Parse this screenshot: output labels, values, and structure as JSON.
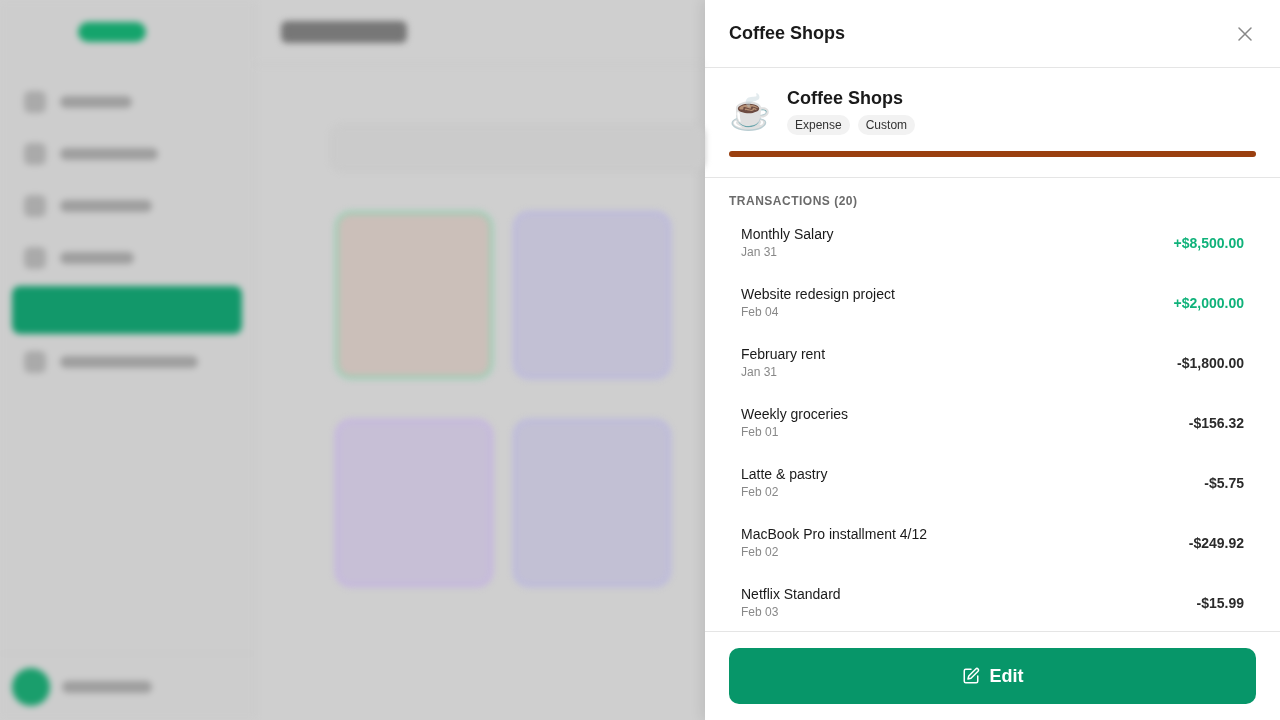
{
  "panel": {
    "title": "Coffee Shops",
    "category": {
      "emoji": "☕",
      "name": "Coffee Shops",
      "tags": [
        "Expense",
        "Custom"
      ],
      "level": 1
    },
    "section_title": "TRANSACTIONS (20)",
    "transactions": [
      {
        "description": "Monthly Salary",
        "date": "Jan 31",
        "amount": "+$8,500.00",
        "kind": "income"
      },
      {
        "description": "Website redesign project",
        "date": "Feb 04",
        "amount": "+$2,000.00",
        "kind": "income"
      },
      {
        "description": "February rent",
        "date": "Jan 31",
        "amount": "-$1,800.00",
        "kind": "expense"
      },
      {
        "description": "Weekly groceries",
        "date": "Feb 01",
        "amount": "-$156.32",
        "kind": "expense"
      },
      {
        "description": "Latte & pastry",
        "date": "Feb 02",
        "amount": "-$5.75",
        "kind": "expense"
      },
      {
        "description": "MacBook Pro installment 4/12",
        "date": "Feb 02",
        "amount": "-$249.92",
        "kind": "expense"
      },
      {
        "description": "Netflix Standard",
        "date": "Feb 03",
        "amount": "-$15.99",
        "kind": "expense"
      }
    ],
    "edit_button": "Edit"
  }
}
